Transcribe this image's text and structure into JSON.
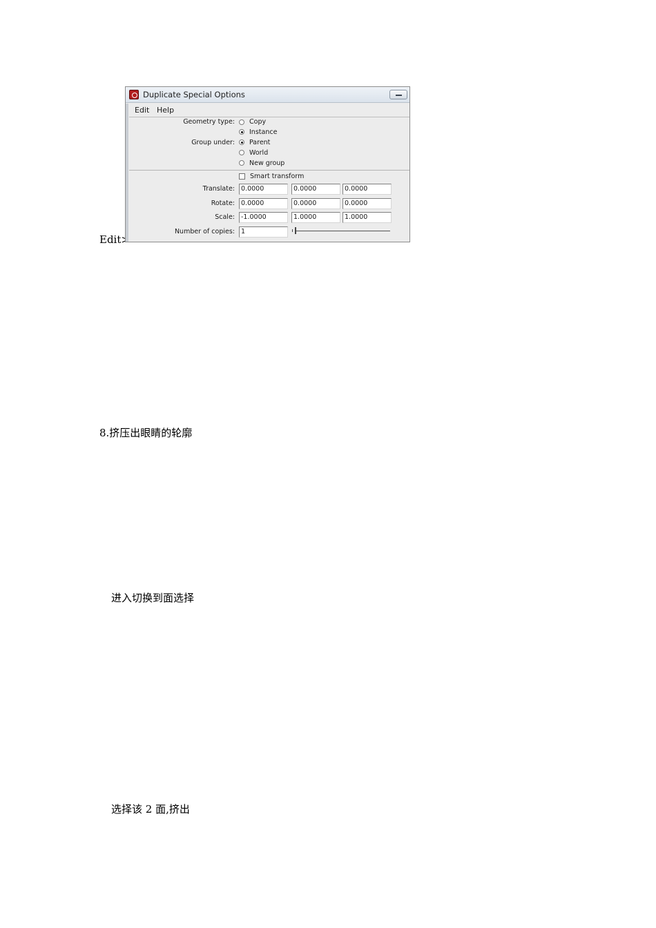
{
  "doc": {
    "edit_prefix": "Edit>",
    "step_8": "8.挤压出眼睛的轮廓",
    "line_2": "进入切换到面选择",
    "line_3": "选择该 2 面,挤出"
  },
  "dialog": {
    "title": "Duplicate Special Options",
    "menu": [
      "Edit",
      "Help"
    ],
    "geometry_type": {
      "label": "Geometry type:",
      "options": [
        "Copy",
        "Instance"
      ],
      "selected": "Instance"
    },
    "group_under": {
      "label": "Group under:",
      "options": [
        "Parent",
        "World",
        "New group"
      ],
      "selected": "Parent"
    },
    "smart_transform": {
      "label": "Smart transform",
      "checked": false
    },
    "translate": {
      "label": "Translate:",
      "values": [
        "0.0000",
        "0.0000",
        "0.0000"
      ]
    },
    "rotate": {
      "label": "Rotate:",
      "values": [
        "0.0000",
        "0.0000",
        "0.0000"
      ]
    },
    "scale": {
      "label": "Scale:",
      "values": [
        "-1.0000",
        "1.0000",
        "1.0000"
      ]
    },
    "copies": {
      "label": "Number of copies:",
      "value": "1"
    }
  }
}
